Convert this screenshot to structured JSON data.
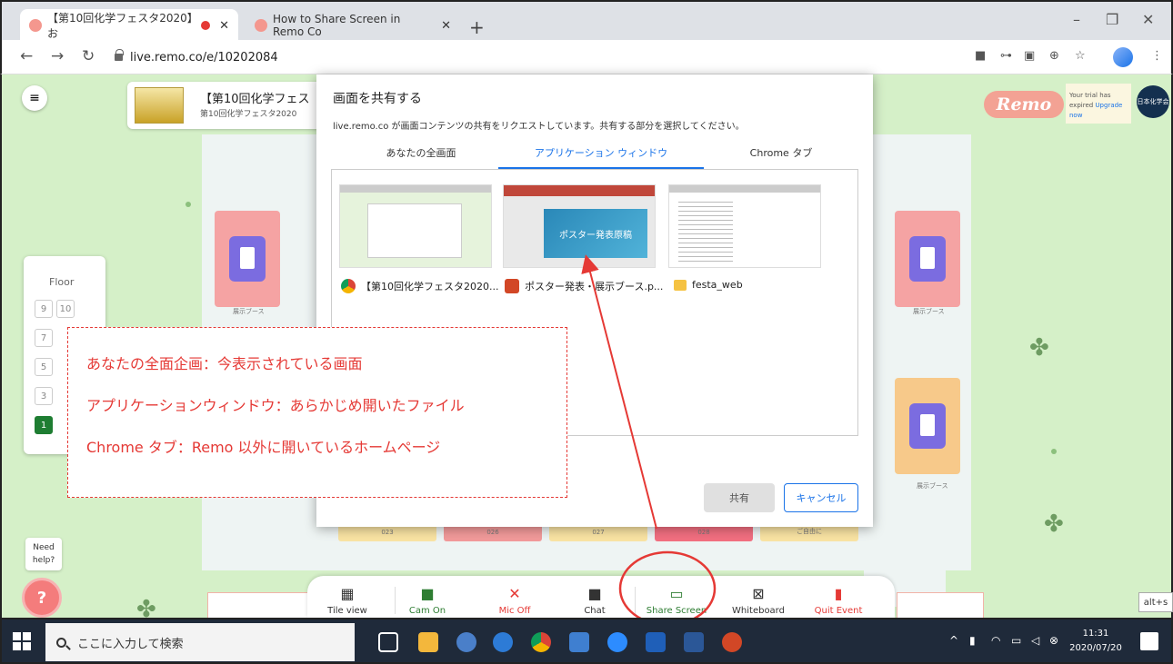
{
  "browser": {
    "tabs": [
      {
        "title": "【第10回化学フェスタ2020】お"
      },
      {
        "title": "How to Share Screen in Remo Co"
      }
    ],
    "new_tab": "+",
    "url": "live.remo.co/e/10202084"
  },
  "remo": {
    "event_title": "【第10回化学フェス",
    "event_subtitle": "第10回化学フェスタ2020",
    "logo_text": "Remo",
    "trial_text": "Your trial has expired",
    "upgrade_link": "Upgrade now",
    "org_badge": "日本化学会",
    "floor_label": "Floor",
    "floors": [
      "9",
      "10",
      "7",
      "5",
      "3",
      "1"
    ],
    "active_floor": "1",
    "booth_label": "展示ブース",
    "tables": [
      "023",
      "026",
      "027",
      "028",
      "ご自由に"
    ],
    "need_help": "Need help?",
    "toolbar": [
      {
        "label": "Tile view",
        "icon": "grid-icon"
      },
      {
        "label": "Cam On",
        "icon": "camera-icon"
      },
      {
        "label": "Mic Off",
        "icon": "mic-off-icon"
      },
      {
        "label": "Chat",
        "icon": "chat-icon"
      },
      {
        "label": "Share Screen",
        "icon": "screen-share-icon"
      },
      {
        "label": "Whiteboard",
        "icon": "whiteboard-icon"
      },
      {
        "label": "Quit Event",
        "icon": "exit-icon"
      }
    ]
  },
  "dialog": {
    "title": "画面を共有する",
    "description": "live.remo.co が画面コンテンツの共有をリクエストしています。共有する部分を選択してください。",
    "tabs": [
      "あなたの全画面",
      "アプリケーション ウィンドウ",
      "Chrome タブ"
    ],
    "active_tab": 1,
    "windows": [
      {
        "label": "【第10回化学フェスタ2020...",
        "icon": "chrome-icon"
      },
      {
        "label": "ポスター発表・展示ブース.p...",
        "icon": "powerpoint-icon",
        "slide_text": "ポスター発表原稿"
      },
      {
        "label": "festa_web",
        "icon": "folder-icon"
      }
    ],
    "share_button": "共有",
    "cancel_button": "キャンセル"
  },
  "annotation": {
    "lines": [
      "あなたの全面企画：今表示されている画面",
      "アプリケーションウィンドウ：あらかじめ開いたファイル",
      "Chrome タブ：Remo 以外に開いているホームページ"
    ],
    "color": "#e53935"
  },
  "taskbar": {
    "search_placeholder": "ここに入力して検索",
    "time": "11:31",
    "date": "2020/07/20",
    "tooltip": "alt+s"
  }
}
